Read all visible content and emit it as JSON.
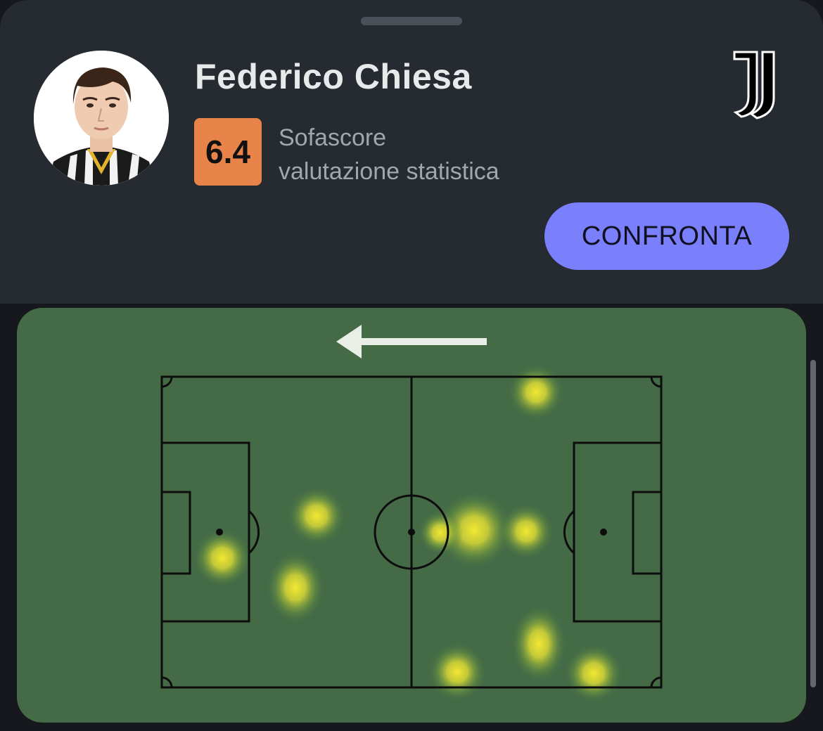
{
  "player": {
    "name": "Federico Chiesa",
    "avatar_icon": "player-photo",
    "club_logo_icon": "juventus-logo"
  },
  "rating": {
    "value": "6.4",
    "label_line1": "Sofascore",
    "label_line2": "valutazione statistica",
    "badge_color": "#e8844a"
  },
  "actions": {
    "compare_label": "CONFRONTA",
    "compare_color": "#7a7ffb"
  },
  "heatmap": {
    "direction_icon": "arrow-left-icon",
    "pitch_color": "#446b46",
    "attack_direction": "left"
  }
}
